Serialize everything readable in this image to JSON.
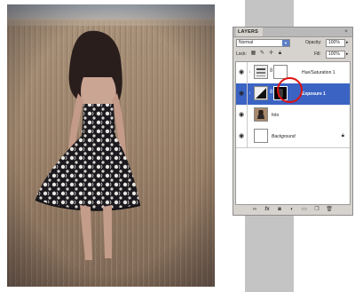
{
  "panel": {
    "tab_label": "LAYERS",
    "close_glyph": "×",
    "blend_mode": "Normal",
    "opacity_label": "Opacity:",
    "opacity_value": "100%",
    "lock_label": "Lock:",
    "fill_label": "Fill:",
    "fill_value": "100%"
  },
  "layers": [
    {
      "name": "Hue/Saturation 1",
      "type": "adjustment-hue-saturation",
      "visible": true,
      "selected": false
    },
    {
      "name": "Exposure 1",
      "type": "adjustment-exposure",
      "visible": true,
      "selected": true
    },
    {
      "name": "foto",
      "type": "image",
      "visible": true,
      "selected": false
    },
    {
      "name": "Background",
      "type": "background",
      "visible": true,
      "selected": false,
      "locked": true
    }
  ],
  "footer_icons": [
    "link-layers-icon",
    "fx-icon",
    "add-mask-icon",
    "new-adjustment-layer-icon",
    "new-group-icon",
    "new-layer-icon",
    "delete-layer-icon"
  ],
  "colors": {
    "selection": "#3a63c3",
    "callout": "#e01010",
    "panel_bg": "#d6d3ce"
  }
}
